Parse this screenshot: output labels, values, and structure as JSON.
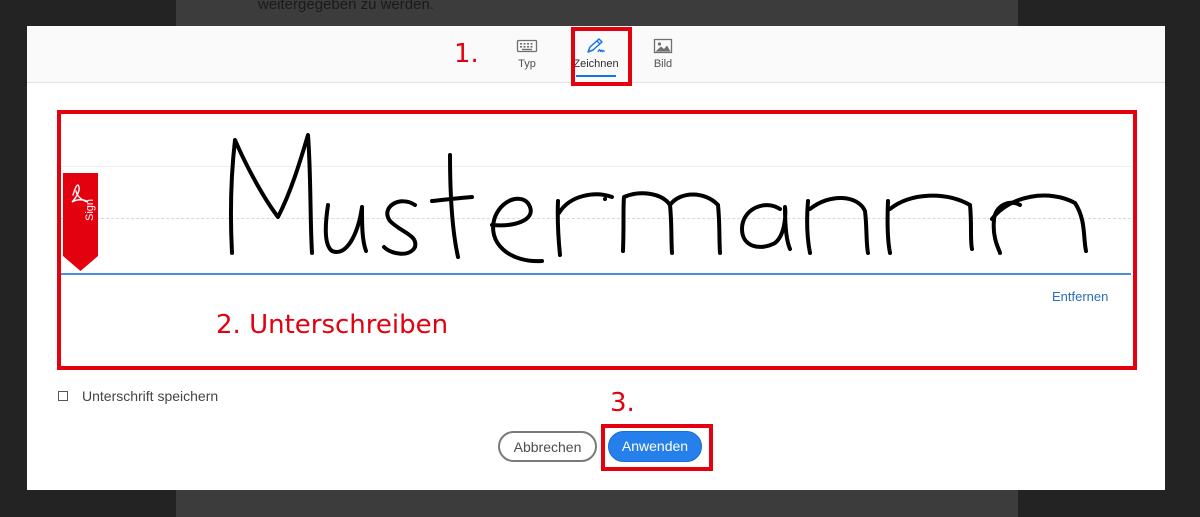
{
  "background": {
    "document_text": "weitergegeben zu werden."
  },
  "tabs": [
    {
      "label": "Typ",
      "icon": "keyboard-icon"
    },
    {
      "label": "Zeichnen",
      "icon": "pen-draw-icon",
      "active": true
    },
    {
      "label": "Bild",
      "icon": "image-icon"
    }
  ],
  "draw_area": {
    "brand_tag": "Sign",
    "signature_text": "Mustermann",
    "remove_label": "Entfernen"
  },
  "save_signature": {
    "label": "Unterschrift speichern",
    "checked": false
  },
  "buttons": {
    "cancel": "Abbrechen",
    "apply": "Anwenden"
  },
  "annotations": {
    "step1": "1.",
    "step2": "2. Unterschreiben",
    "step3": "3."
  },
  "colors": {
    "accent": "#1473e6",
    "apply_button": "#2680eb",
    "annotation_red": "#e3000f",
    "sign_tag": "#e3000f"
  }
}
